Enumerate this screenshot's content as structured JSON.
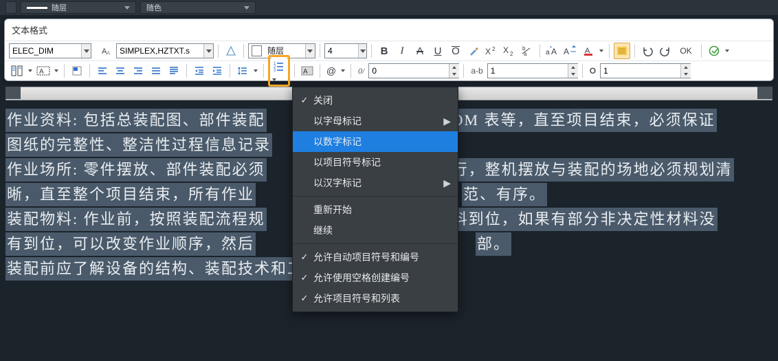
{
  "top_strip": {
    "layer_combo": "随层",
    "color_combo": "随色"
  },
  "panel": {
    "title": "文本格式",
    "row1": {
      "style_name": "ELEC_DIM",
      "font_name": "SIMPLEX,HZTXT.s",
      "layer": "随层",
      "height": "4",
      "bold": "B",
      "italic": "I",
      "strike": "A",
      "underline": "U",
      "overline": "O",
      "ok_label": "OK"
    },
    "row2": {
      "tracking_lbl": "0/",
      "tracking_val": "0",
      "ab_lbl": "a-b",
      "ab_val": "1",
      "o_lbl": "O",
      "o_val": "1",
      "at": "@"
    }
  },
  "menu": {
    "items": [
      {
        "label": "关闭",
        "checked": true
      },
      {
        "label": "以字母标记",
        "submenu": true
      },
      {
        "label": "以数字标记",
        "selected": true
      },
      {
        "label": "以项目符号标记"
      },
      {
        "label": "以汉字标记",
        "submenu": true
      }
    ],
    "items2": [
      {
        "label": "重新开始"
      },
      {
        "label": "继续"
      }
    ],
    "items3": [
      {
        "label": "允许自动项目符号和编号",
        "checked": true
      },
      {
        "label": "允许使用空格创建编号",
        "checked": true
      },
      {
        "label": "允许项目符号和列表",
        "checked": true
      }
    ]
  },
  "editor": {
    "l1a": "作业资料: 包括总装配图、部件装配",
    "l1b": "OM 表等，直至项目结束，必须保证",
    "l2a": "图纸的完整性、整洁性过程信息记录",
    "l3a": "作业场所: 零件摆放、部件装配必须",
    "l3b": "行，整机摆放与装配的场地必须规划清",
    "l4a": "晰，直至整个项目结束，所有作业",
    "l4b": "范、有序。",
    "l5a": "装配物料: 作业前，按照装配流程规",
    "l5b": "料到位，如果有部分非决定性材料没",
    "l6a": "有到位，可以改变作业顺序，然后",
    "l6b": "部。",
    "l7a": "装配前应了解设备的结构、装配技术和工艺要求。"
  }
}
